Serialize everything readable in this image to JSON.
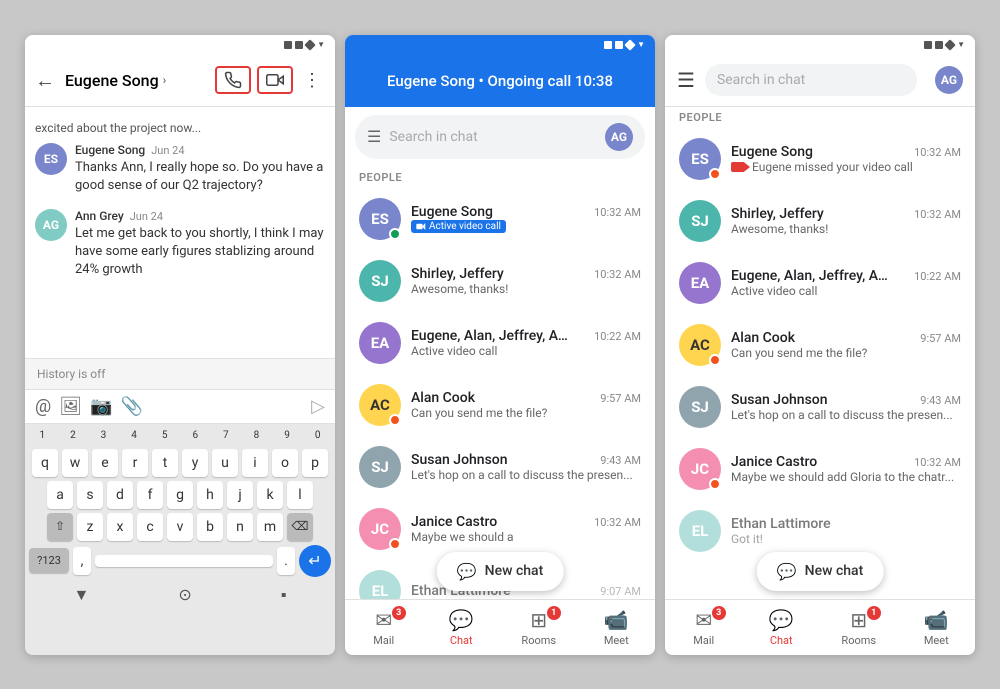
{
  "phone1": {
    "header": {
      "title": "Eugene Song",
      "back_label": "←",
      "arrow_label": "›",
      "more_label": "⋮"
    },
    "preview_text": "excited about the project now...",
    "messages": [
      {
        "sender": "Eugene Song",
        "date": "Jun 24",
        "text": "Thanks Ann, I really hope so. Do you have a good sense of our Q2 trajectory?",
        "avatar_color": "#7986cb",
        "initials": "ES"
      },
      {
        "sender": "Ann Grey",
        "date": "Jun 24",
        "text": "Let me get back to you shortly, I think I may have some early figures stablizing around 24% growth",
        "avatar_color": "#80cbc4",
        "initials": "AG"
      }
    ],
    "history_bar": "History is off",
    "compose_icons": [
      "@",
      "🖼",
      "📷",
      "📎"
    ],
    "keyboard": {
      "row1": [
        "q",
        "w",
        "e",
        "r",
        "t",
        "y",
        "u",
        "i",
        "o",
        "p"
      ],
      "row2": [
        "a",
        "s",
        "d",
        "f",
        "g",
        "h",
        "j",
        "k",
        "l"
      ],
      "row3": [
        "z",
        "x",
        "c",
        "v",
        "b",
        "n",
        "m"
      ],
      "bottom_left": "?123",
      "bottom_right": "↵"
    }
  },
  "phone2": {
    "header": {
      "title": "Eugene Song • Ongoing call 10:38"
    },
    "search_placeholder": "Search in chat",
    "section_label": "PEOPLE",
    "chats": [
      {
        "name": "Eugene Song",
        "time": "10:32 AM",
        "preview": "Active video call",
        "avatar_color": "#7986cb",
        "initials": "ES",
        "has_video_badge": true,
        "dot": "green"
      },
      {
        "name": "Shirley, Jeffery",
        "time": "10:32 AM",
        "preview": "Awesome, thanks!",
        "avatar_color": "#4db6ac",
        "initials": "SJ",
        "has_video_badge": false,
        "dot": "none"
      },
      {
        "name": "Eugene, Alan, Jeffrey, Ama...",
        "time": "10:22 AM",
        "preview": "Active video call",
        "avatar_color": "#9575cd",
        "initials": "EA",
        "has_video_badge": false,
        "dot": "none"
      },
      {
        "name": "Alan Cook",
        "time": "9:57 AM",
        "preview": "Can you send me the file?",
        "avatar_color": "#ffd54f",
        "initials": "AC",
        "dot": "orange"
      },
      {
        "name": "Susan Johnson",
        "time": "9:43 AM",
        "preview": "Let's hop on a call to discuss the presen...",
        "avatar_color": "#90a4ae",
        "initials": "SJ",
        "dot": "none"
      },
      {
        "name": "Janice Castro",
        "time": "10:32 AM",
        "preview": "Maybe we should a",
        "avatar_color": "#f48fb1",
        "initials": "JC",
        "dot": "orange"
      },
      {
        "name": "Ethan Lattimore",
        "time": "9:07 AM",
        "preview": "",
        "avatar_color": "#80cbc4",
        "initials": "EL",
        "dot": "none"
      }
    ],
    "new_chat_label": "New chat",
    "bottom_nav": [
      {
        "label": "Mail",
        "icon": "✉",
        "active": false,
        "badge": "3"
      },
      {
        "label": "Chat",
        "icon": "💬",
        "active": true,
        "badge": ""
      },
      {
        "label": "Rooms",
        "icon": "⊞",
        "active": false,
        "badge": "1"
      },
      {
        "label": "Meet",
        "icon": "📹",
        "active": false,
        "badge": ""
      }
    ]
  },
  "phone3": {
    "header": {
      "menu_label": "☰",
      "search_placeholder": "Search in chat"
    },
    "section_label": "PEOPLE",
    "chats": [
      {
        "name": "Eugene Song",
        "time": "10:32 AM",
        "preview": "Eugene missed your video call",
        "avatar_color": "#7986cb",
        "initials": "ES",
        "missed_video": true,
        "dot": "orange"
      },
      {
        "name": "Shirley, Jeffery",
        "time": "10:32 AM",
        "preview": "Awesome, thanks!",
        "avatar_color": "#4db6ac",
        "initials": "SJ",
        "dot": "none"
      },
      {
        "name": "Eugene, Alan, Jeffrey, Ama...",
        "time": "10:22 AM",
        "preview": "Active video call",
        "avatar_color": "#9575cd",
        "initials": "EA",
        "dot": "none"
      },
      {
        "name": "Alan Cook",
        "time": "9:57 AM",
        "preview": "Can you send me the file?",
        "avatar_color": "#ffd54f",
        "initials": "AC",
        "dot": "orange"
      },
      {
        "name": "Susan Johnson",
        "time": "9:43 AM",
        "preview": "Let's hop on a call to discuss the presen...",
        "avatar_color": "#90a4ae",
        "initials": "SJ",
        "dot": "none"
      },
      {
        "name": "Janice Castro",
        "time": "10:32 AM",
        "preview": "Maybe we should add Gloria to the chatr...",
        "avatar_color": "#f48fb1",
        "initials": "JC",
        "dot": "orange"
      },
      {
        "name": "Ethan Lattimore",
        "time": "",
        "preview": "Got it!",
        "avatar_color": "#80cbc4",
        "initials": "EL",
        "dot": "none"
      }
    ],
    "new_chat_label": "New chat",
    "bottom_nav": [
      {
        "label": "Mail",
        "icon": "✉",
        "active": false,
        "badge": "3"
      },
      {
        "label": "Chat",
        "icon": "💬",
        "active": true,
        "badge": ""
      },
      {
        "label": "Rooms",
        "icon": "⊞",
        "active": false,
        "badge": "1"
      },
      {
        "label": "Meet",
        "icon": "📹",
        "active": false,
        "badge": ""
      }
    ]
  }
}
